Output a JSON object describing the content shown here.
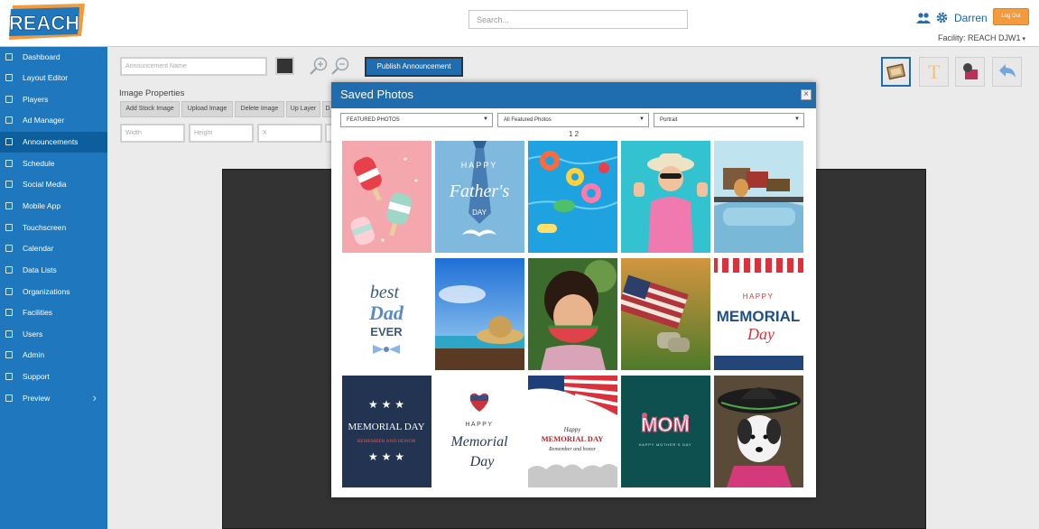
{
  "header": {
    "logo_text": "REACH",
    "search_placeholder": "Search...",
    "user_name": "Darren",
    "logout_label": "Log Out",
    "facility": "Facility: REACH DJW1",
    "facility_caret": "▾"
  },
  "sidebar": {
    "items": [
      {
        "label": "Dashboard"
      },
      {
        "label": "Layout Editor"
      },
      {
        "label": "Players"
      },
      {
        "label": "Ad Manager"
      },
      {
        "label": "Announcements",
        "active": true
      },
      {
        "label": "Schedule"
      },
      {
        "label": "Social Media"
      },
      {
        "label": "Mobile App"
      },
      {
        "label": "Touchscreen"
      },
      {
        "label": "Calendar"
      },
      {
        "label": "Data Lists"
      },
      {
        "label": "Organizations"
      },
      {
        "label": "Facilities"
      },
      {
        "label": "Users"
      },
      {
        "label": "Admin"
      },
      {
        "label": "Support"
      },
      {
        "label": "Preview"
      }
    ],
    "preview_chevron": "›"
  },
  "editor": {
    "announcement_name_placeholder": "Announcement Name",
    "publish_label": "Publish Announcement",
    "image_properties_label": "Image Properties",
    "buttons": [
      "Add Stock Image",
      "Upload Image",
      "Delete Image",
      "Up Layer",
      "D"
    ],
    "fields": [
      "Width",
      "Height",
      "X",
      ""
    ],
    "tool_text_glyph": "T",
    "colors": {
      "sidebar": "#1f77bd",
      "accent": "#1f6cae",
      "logout": "#f39b3c",
      "canvas": "#333333"
    }
  },
  "modal": {
    "title": "Saved Photos",
    "close_glyph": "×",
    "dropdowns": [
      {
        "value": "FEATURED PHOTOS"
      },
      {
        "value": "All Featured Photos"
      },
      {
        "value": "Portrait"
      }
    ],
    "pagination": "1 2",
    "tile_texts": {
      "fathers_day": [
        "HAPPY",
        "Father's",
        "DAY"
      ],
      "best_dad": [
        "best",
        "Dad",
        "EVER"
      ],
      "memorial_1": [
        "HAPPY",
        "MEMORIAL",
        "Day"
      ],
      "memorial_2": [
        "MEMORIAL DAY",
        "REMEMBER AND HONOR"
      ],
      "memorial_3": [
        "HAPPY",
        "Memorial",
        "Day"
      ],
      "memorial_4": [
        "Happy",
        "MEMORIAL DAY",
        "Remember and honor"
      ],
      "mom": [
        "MOM",
        "HAPPY MOTHER'S DAY"
      ]
    }
  }
}
